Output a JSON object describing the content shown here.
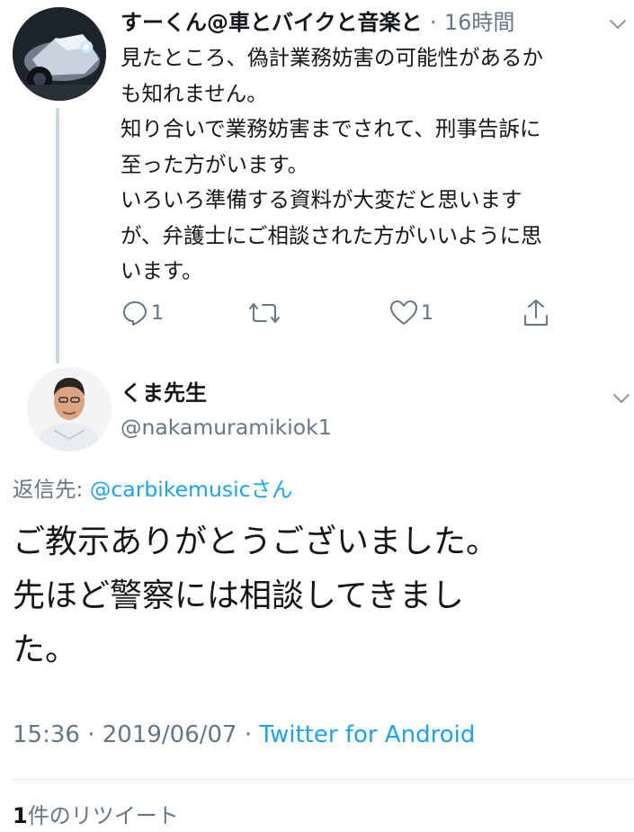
{
  "parent_tweet": {
    "author_name": "すーくん@車とバイクと音楽と",
    "separator": "·",
    "time_ago": "16時間",
    "body_lines": [
      "見たところ、偽計業務妨害の可能性があるか",
      "も知れません。",
      "知り合いで業務妨害までされて、刑事告訴に",
      "至った方がいます。",
      "いろいろ準備する資料が大変だと思います",
      "が、弁護士にご相談された方がいいように思",
      "います。"
    ],
    "reply_count": "1",
    "like_count": "1"
  },
  "main_tweet": {
    "author_name": "くま先生",
    "author_handle": "@nakamuramikiok1",
    "reply_to_label": "返信先: ",
    "reply_to_mention": "@carbikemusicさん",
    "text_lines": [
      "ご教示ありがとうございました。",
      "先ほど警察には相談してきまし",
      "た。"
    ],
    "time": "15:36",
    "date": "2019/06/07",
    "dot": " · ",
    "source": "Twitter for Android",
    "retweet_number": "1",
    "retweet_label": "件のリツイート"
  },
  "colors": {
    "text": "#14171a",
    "secondary": "#657786",
    "link": "#1da1f2",
    "divider": "#e1e8ed",
    "thread_line": "#ccd6dd"
  },
  "icons": [
    "chevron-down-icon",
    "reply-icon",
    "retweet-icon",
    "like-icon",
    "share-icon"
  ]
}
